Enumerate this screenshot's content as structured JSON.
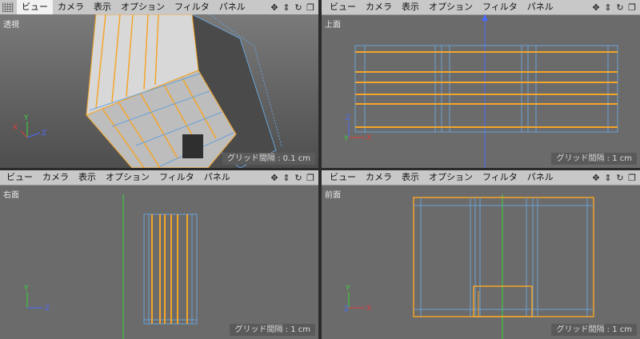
{
  "menus": [
    "ビュー",
    "カメラ",
    "表示",
    "オプション",
    "フィルタ",
    "パネル"
  ],
  "toolbar_icons": [
    "move-icon",
    "zoom-icon",
    "rotate-icon",
    "maximize-icon"
  ],
  "viewports": [
    {
      "id": "perspective",
      "label": "透視",
      "grid_spacing": "グリッド間隔 : 0.1 cm",
      "active_menu": "ビュー"
    },
    {
      "id": "top",
      "label": "上面",
      "grid_spacing": "グリッド間隔 : 1 cm"
    },
    {
      "id": "right",
      "label": "右面",
      "grid_spacing": "グリッド間隔 : 1 cm"
    },
    {
      "id": "front",
      "label": "前面",
      "grid_spacing": "グリッド間隔 : 1 cm"
    }
  ],
  "axes": {
    "x": "X",
    "y": "Y",
    "z": "Z"
  },
  "colors": {
    "selection_edge": "#f4a52a",
    "wire": "#6aa1d6",
    "axis_x": "#e03b3b",
    "axis_y": "#3bd43b",
    "axis_z": "#4b6bff",
    "viewport_bg": "#6b6b6b"
  }
}
